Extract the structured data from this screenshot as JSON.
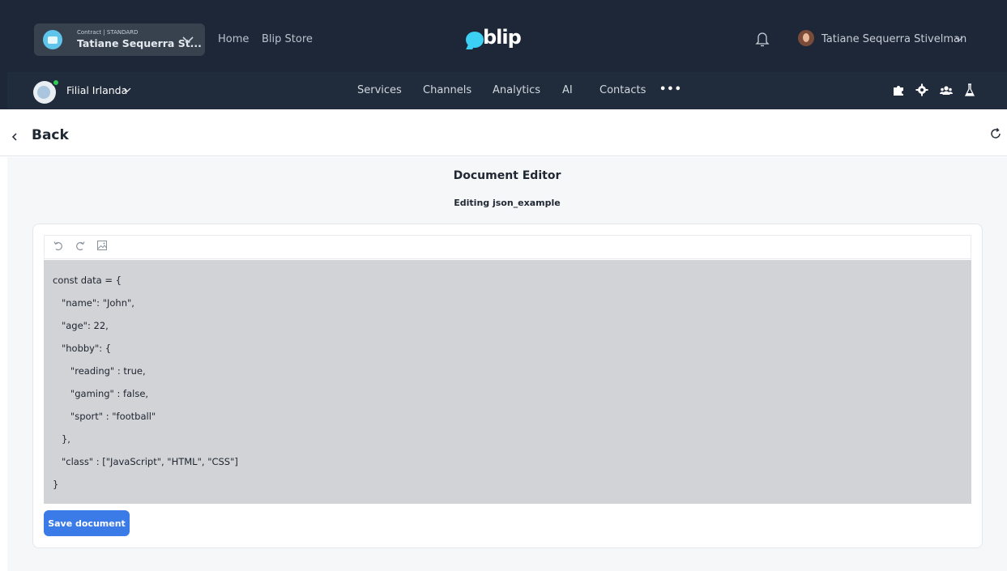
{
  "header": {
    "contract_caption": "Contract | STANDARD",
    "contract_name": "Tatiane Sequerra St...",
    "nav": [
      "Home",
      "Blip Store"
    ],
    "logo_text": "blip",
    "user_name": "Tatiane Sequerra Stivelman"
  },
  "subheader": {
    "bot_name": "Filial Irlanda",
    "nav": [
      "Services",
      "Channels",
      "Analytics",
      "AI",
      "Contacts"
    ],
    "more": "•••"
  },
  "page": {
    "back_label": "Back",
    "title": "Document Editor",
    "subtitle": "Editing json_example"
  },
  "editor": {
    "lines": [
      "const data = {",
      "   \"name\": \"John\",",
      "   \"age\": 22,",
      "   \"hobby\": {",
      "      \"reading\" : true,",
      "      \"gaming\" : false,",
      "      \"sport\" : \"football\"",
      "   },",
      "   \"class\" : [\"JavaScript\", \"HTML\", \"CSS\"]",
      "}"
    ]
  },
  "actions": {
    "save_label": "Save document"
  },
  "colors": {
    "header_bg": "#1d2737",
    "accent": "#3a7be8",
    "logo": "#3cd0f4",
    "editor_bg": "#d1d3d6"
  }
}
